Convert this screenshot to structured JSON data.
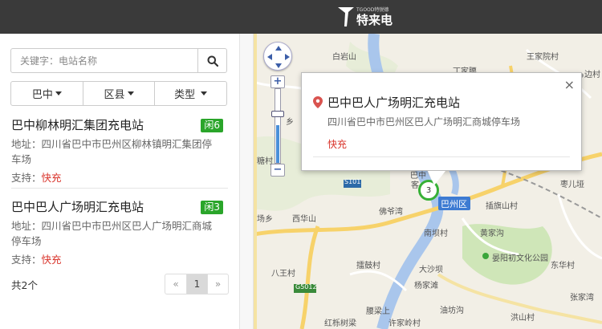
{
  "header": {
    "logo_small": "TGOOD特锐德",
    "logo_big": "特来电"
  },
  "sidebar": {
    "search": {
      "placeholder": "关键字：电站名称",
      "button_icon": "search-icon"
    },
    "filters": [
      {
        "label": "巴中"
      },
      {
        "label": "区县"
      },
      {
        "label": "类型"
      }
    ],
    "stations": [
      {
        "name": "巴中柳林明汇集团充电站",
        "badge": "闲6",
        "address_label": "地址：",
        "address": "四川省巴中市巴州区柳林镇明汇集团停车场",
        "support_label": "支持：",
        "support": "快充"
      },
      {
        "name": "巴中巴人广场明汇充电站",
        "badge": "闲3",
        "address_label": "地址：",
        "address": "四川省巴中市巴州区巴人广场明汇商城停车场",
        "support_label": "支持：",
        "support": "快充"
      }
    ],
    "total": "共2个",
    "pager": {
      "first": "«",
      "current": "1",
      "last": "»"
    }
  },
  "map": {
    "popup": {
      "title": "巴中巴人广场明汇充电站",
      "address": "四川省巴中市巴州区巴人广场明汇商城停车场",
      "type": "快充",
      "close": "×"
    },
    "marker_label": "3",
    "district_label": "巴州区",
    "labels": [
      {
        "text": "白岩山"
      },
      {
        "text": "丁家腰"
      },
      {
        "text": "王家院村"
      },
      {
        "text": "边村"
      },
      {
        "text": "乡"
      },
      {
        "text": "糖村"
      },
      {
        "text": "巴中"
      },
      {
        "text": "客"
      },
      {
        "text": "S101"
      },
      {
        "text": "枣儿垭"
      },
      {
        "text": "插旗山村"
      },
      {
        "text": "场乡"
      },
      {
        "text": "西华山"
      },
      {
        "text": "佛爷湾"
      },
      {
        "text": "南坝村"
      },
      {
        "text": "黄家沟"
      },
      {
        "text": "晏阳初文化公园"
      },
      {
        "text": "擂鼓村"
      },
      {
        "text": "大沙坝"
      },
      {
        "text": "东华村"
      },
      {
        "text": "八王村"
      },
      {
        "text": "G5012"
      },
      {
        "text": "杨家滩"
      },
      {
        "text": "张家湾"
      },
      {
        "text": "油坊沟"
      },
      {
        "text": "腰梁上"
      },
      {
        "text": "红栎树梁"
      },
      {
        "text": "许家岭村"
      },
      {
        "text": "洪山村"
      }
    ],
    "colors": {
      "river": "#a9c6ec",
      "road": "#f7d26a",
      "green": "#cfe6b8",
      "marker_ring": "#36b036"
    }
  }
}
